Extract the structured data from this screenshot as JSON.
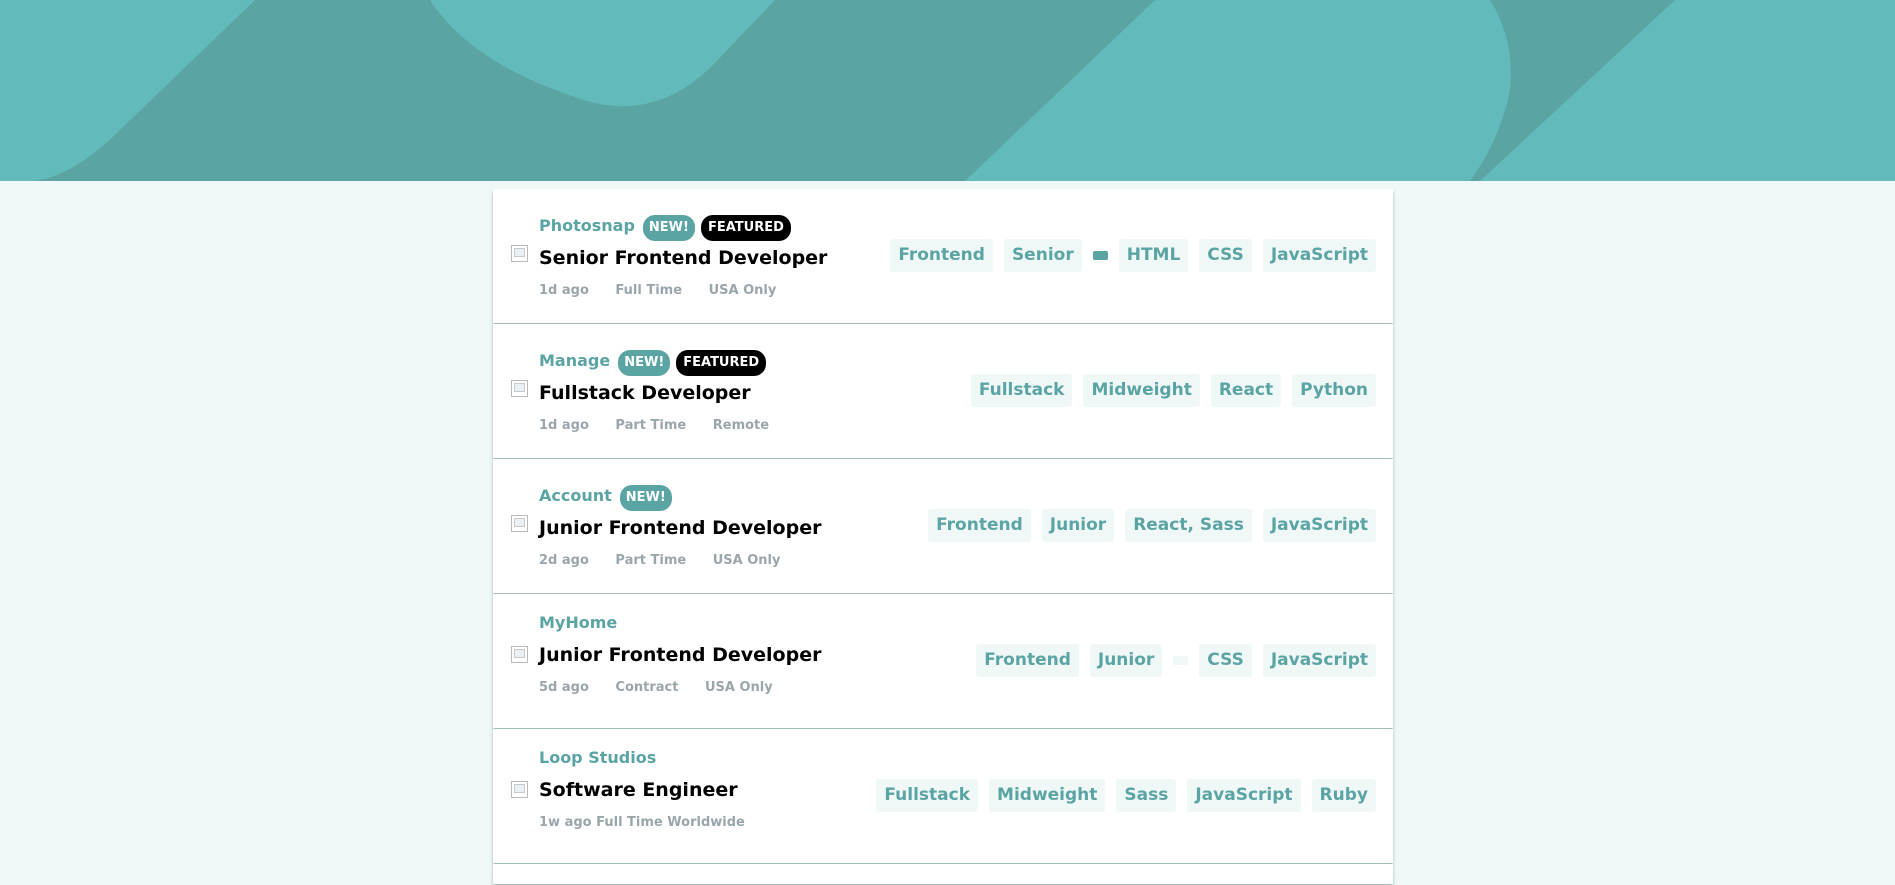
{
  "colors": {
    "primary": "#5ba4a4",
    "header_light": "#63baba",
    "background": "#eff7f7",
    "new_badge": "#5ba4a4",
    "featured_badge": "#000000",
    "meta_text": "#9aa6ab"
  },
  "jobs": [
    {
      "company": "Photosnap",
      "new_label": "NEW!",
      "featured_label": "FEATURED",
      "position": "Senior Frontend Developer",
      "posted": "1d ago",
      "contract": "Full Time",
      "location": "USA Only",
      "tags": [
        "Frontend",
        "Senior",
        "",
        "HTML",
        "CSS",
        "JavaScript"
      ]
    },
    {
      "company": "Manage",
      "new_label": "NEW!",
      "featured_label": "FEATURED",
      "position": "Fullstack Developer",
      "posted": "1d ago",
      "contract": "Part Time",
      "location": "Remote",
      "tags": [
        "Fullstack",
        "Midweight",
        "React",
        "Python"
      ]
    },
    {
      "company": "Account",
      "new_label": "NEW!",
      "position": "Junior Frontend Developer",
      "posted": "2d ago",
      "contract": "Part Time",
      "location": "USA Only",
      "tags": [
        "Frontend",
        "Junior",
        "React, Sass",
        "JavaScript"
      ]
    },
    {
      "company": "MyHome",
      "position": "Junior Frontend Developer",
      "posted": "5d ago",
      "contract": "Contract",
      "location": "USA Only",
      "tags": [
        "Frontend",
        "Junior",
        "",
        "CSS",
        "JavaScript"
      ]
    },
    {
      "company": "Loop Studios",
      "position": "Software Engineer",
      "posted": "1w ago",
      "contract": "Full Time",
      "location": "Worldwide",
      "tags": [
        "Fullstack",
        "Midweight",
        "Sass",
        "JavaScript",
        "Ruby"
      ]
    }
  ]
}
